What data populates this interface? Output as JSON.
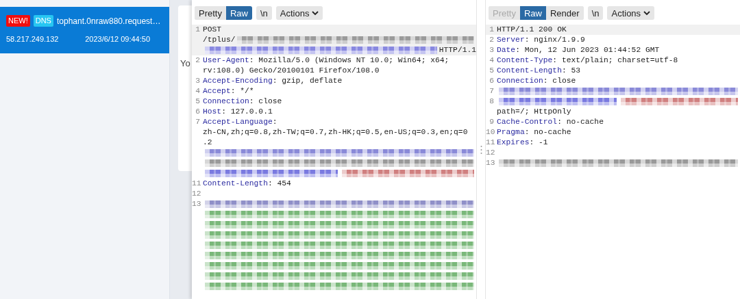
{
  "sidebar": {
    "items": [
      {
        "selected": true,
        "badges": [
          {
            "text": "NEW!",
            "kind": "new"
          },
          {
            "text": "DNS",
            "kind": "type"
          }
        ],
        "title": "tophant.0nraw880.request…",
        "ip": "58.217.249.132",
        "time": "2023/6/12 09:44:50"
      }
    ]
  },
  "background_card": {
    "text": "Yo"
  },
  "request": {
    "tabs": [
      {
        "label": "Pretty",
        "selected": false,
        "disabled": false
      },
      {
        "label": "Raw",
        "selected": true,
        "disabled": false
      }
    ],
    "newline_button": "\\n",
    "actions_button": "Actions",
    "lines": [
      {
        "number": "1",
        "highlighted": true,
        "rows": [
          [
            {
              "kind": "text",
              "text": "POST"
            }
          ],
          [
            {
              "kind": "text",
              "text": "/tplus/"
            },
            {
              "kind": "redacted",
              "color": "#9a9a9a"
            }
          ],
          [
            {
              "kind": "redacted",
              "color": "#8888e0"
            },
            {
              "kind": "text",
              "text": "HTTP/1.1"
            }
          ]
        ]
      },
      {
        "number": "2",
        "highlighted": false,
        "rows": [
          [
            {
              "kind": "key",
              "text": "User-Agent"
            },
            {
              "kind": "text",
              "text": ": Mozilla/5.0 (Windows NT 10.0; Win64; x64;"
            }
          ],
          [
            {
              "kind": "text",
              "text": "rv:108.0) Gecko/20100101 Firefox/108.0"
            }
          ]
        ]
      },
      {
        "number": "3",
        "highlighted": false,
        "rows": [
          [
            {
              "kind": "key",
              "text": "Accept-Encoding"
            },
            {
              "kind": "text",
              "text": ": gzip, deflate"
            }
          ]
        ]
      },
      {
        "number": "4",
        "highlighted": false,
        "rows": [
          [
            {
              "kind": "key",
              "text": "Accept"
            },
            {
              "kind": "text",
              "text": ": */*"
            }
          ]
        ]
      },
      {
        "number": "5",
        "highlighted": false,
        "rows": [
          [
            {
              "kind": "key",
              "text": "Connection"
            },
            {
              "kind": "text",
              "text": ": close"
            }
          ]
        ]
      },
      {
        "number": "6",
        "highlighted": false,
        "rows": [
          [
            {
              "kind": "key",
              "text": "Host"
            },
            {
              "kind": "text",
              "text": ": 127.0.0.1"
            }
          ]
        ]
      },
      {
        "number": "7",
        "highlighted": false,
        "rows": [
          [
            {
              "kind": "key",
              "text": "Accept-Language"
            },
            {
              "kind": "text",
              "text": ":"
            }
          ],
          [
            {
              "kind": "text",
              "text": "zh-CN,zh;q=0.8,zh-TW;q=0.7,zh-HK;q=0.5,en-US;q=0.3,en;q=0"
            }
          ],
          [
            {
              "kind": "text",
              "text": ".2"
            }
          ]
        ]
      },
      {
        "highlighted": false,
        "rows": [
          [
            {
              "kind": "redacted",
              "color": "#8a8ad8"
            }
          ],
          [
            {
              "kind": "redacted",
              "color": "#9a9a9a"
            }
          ],
          [
            {
              "kind": "redacted",
              "color": "#7a7ae0"
            },
            {
              "kind": "redacted",
              "color": "#d08080"
            }
          ]
        ]
      },
      {
        "number": "11",
        "highlighted": false,
        "rows": [
          [
            {
              "kind": "key",
              "text": "Content-Length"
            },
            {
              "kind": "text",
              "text": ": 454"
            }
          ]
        ]
      },
      {
        "number": "12",
        "highlighted": false,
        "rows": [
          []
        ]
      },
      {
        "number": "13",
        "highlighted": false,
        "rows": [
          [
            {
              "kind": "redacted",
              "color": "#9090c8"
            }
          ],
          [
            {
              "kind": "redacted",
              "color": "#7ab87a"
            }
          ],
          [
            {
              "kind": "redacted",
              "color": "#7ab87a"
            }
          ],
          [
            {
              "kind": "redacted",
              "color": "#7ab87a"
            }
          ],
          [
            {
              "kind": "redacted",
              "color": "#7ab87a"
            }
          ],
          [
            {
              "kind": "redacted",
              "color": "#7ab87a"
            }
          ],
          [
            {
              "kind": "redacted",
              "color": "#7ab87a"
            }
          ],
          [
            {
              "kind": "redacted",
              "color": "#7ab87a"
            }
          ],
          [
            {
              "kind": "redacted",
              "color": "#7ab87a"
            }
          ]
        ]
      }
    ]
  },
  "response": {
    "tabs": [
      {
        "label": "Pretty",
        "selected": false,
        "disabled": true
      },
      {
        "label": "Raw",
        "selected": true,
        "disabled": false
      },
      {
        "label": "Render",
        "selected": false,
        "disabled": false
      }
    ],
    "newline_button": "\\n",
    "actions_button": "Actions",
    "lines": [
      {
        "number": "1",
        "highlighted": true,
        "rows": [
          [
            {
              "kind": "text",
              "text": "HTTP/1.1 200 OK"
            }
          ]
        ]
      },
      {
        "number": "2",
        "highlighted": false,
        "rows": [
          [
            {
              "kind": "key",
              "text": "Server"
            },
            {
              "kind": "text",
              "text": ": nginx/1.9.9"
            }
          ]
        ]
      },
      {
        "number": "3",
        "highlighted": false,
        "rows": [
          [
            {
              "kind": "key",
              "text": "Date"
            },
            {
              "kind": "text",
              "text": ": Mon, 12 Jun 2023 01:44:52 GMT"
            }
          ]
        ]
      },
      {
        "number": "4",
        "highlighted": false,
        "rows": [
          [
            {
              "kind": "key",
              "text": "Content-Type"
            },
            {
              "kind": "text",
              "text": ": text/plain; charset=utf-8"
            }
          ]
        ]
      },
      {
        "number": "5",
        "highlighted": false,
        "rows": [
          [
            {
              "kind": "key",
              "text": "Content-Length"
            },
            {
              "kind": "text",
              "text": ": 53"
            }
          ]
        ]
      },
      {
        "number": "6",
        "highlighted": false,
        "rows": [
          [
            {
              "kind": "key",
              "text": "Connection"
            },
            {
              "kind": "text",
              "text": ": close"
            }
          ]
        ]
      },
      {
        "number": "7",
        "highlighted": false,
        "rows": [
          [
            {
              "kind": "redacted",
              "color": "#8a8ad8"
            }
          ]
        ]
      },
      {
        "number": "8",
        "highlighted": false,
        "rows": [
          [
            {
              "kind": "redacted",
              "color": "#7a7ae0"
            },
            {
              "kind": "redacted",
              "color": "#d08080"
            }
          ],
          [
            {
              "kind": "text",
              "text": "path=/; HttpOnly"
            }
          ]
        ]
      },
      {
        "number": "9",
        "highlighted": false,
        "rows": [
          [
            {
              "kind": "key",
              "text": "Cache-Control"
            },
            {
              "kind": "text",
              "text": ": no-cache"
            }
          ]
        ]
      },
      {
        "number": "10",
        "highlighted": false,
        "rows": [
          [
            {
              "kind": "key",
              "text": "Pragma"
            },
            {
              "kind": "text",
              "text": ": no-cache"
            }
          ]
        ]
      },
      {
        "number": "11",
        "highlighted": false,
        "rows": [
          [
            {
              "kind": "key",
              "text": "Expires"
            },
            {
              "kind": "text",
              "text": ": -1"
            }
          ]
        ]
      },
      {
        "number": "12",
        "highlighted": false,
        "rows": [
          []
        ]
      },
      {
        "number": "13",
        "highlighted": false,
        "rows": [
          [
            {
              "kind": "redacted",
              "color": "#9a9a9a"
            }
          ]
        ]
      }
    ]
  }
}
